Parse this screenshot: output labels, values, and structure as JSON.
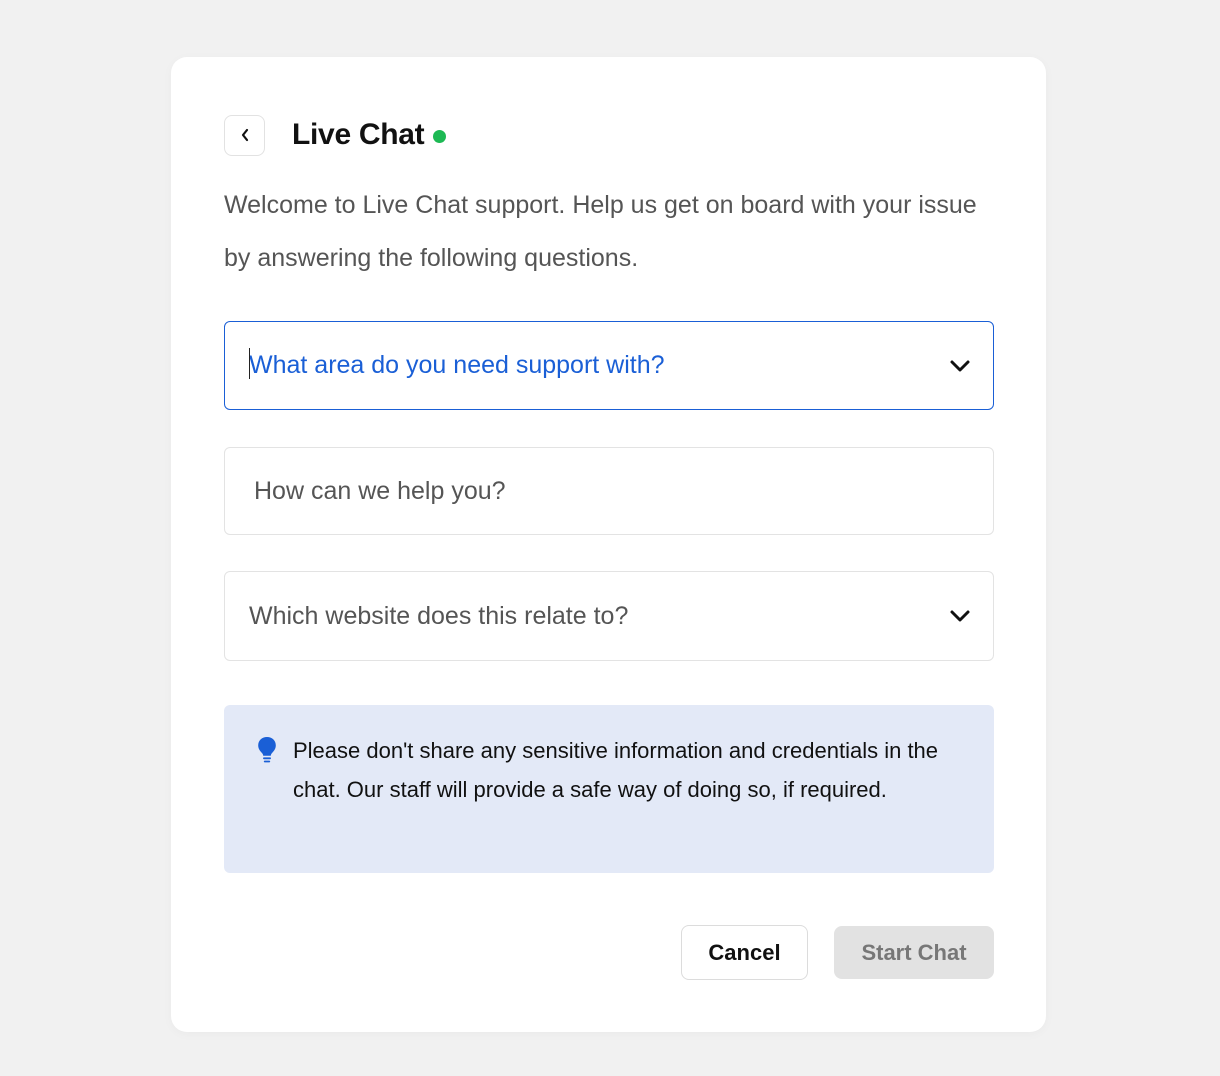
{
  "header": {
    "title": "Live Chat",
    "status_color": "#1db954"
  },
  "intro": "Welcome to Live Chat support. Help us get on board with your issue by answering the following questions.",
  "form": {
    "support_area": {
      "placeholder": "What area do you need support with?",
      "focused": true
    },
    "help_text": {
      "placeholder": "How can we help you?"
    },
    "website": {
      "placeholder": "Which website does this relate to?"
    }
  },
  "notice": {
    "icon": "lightbulb-icon",
    "text": "Please don't share any sensitive information and credentials in the chat. Our staff will provide a safe way of doing so, if required."
  },
  "actions": {
    "cancel_label": "Cancel",
    "start_label": "Start Chat"
  },
  "colors": {
    "accent": "#1a5fd6",
    "notice_bg": "#e3e9f7",
    "page_bg": "#f1f1f1"
  }
}
